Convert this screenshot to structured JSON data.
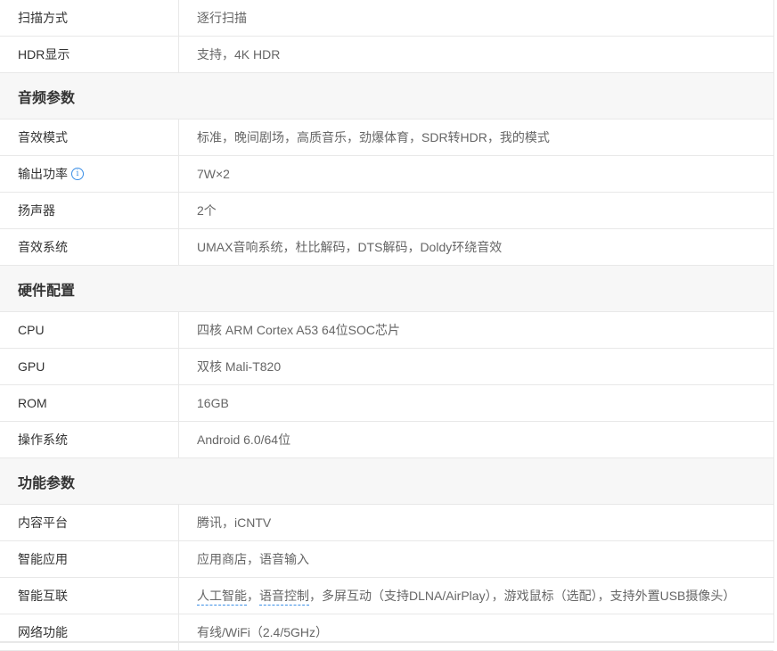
{
  "rows_top": [
    {
      "label": "扫描方式",
      "value": "逐行扫描"
    },
    {
      "label": "HDR显示",
      "value": "支持，4K HDR"
    }
  ],
  "section_audio": "音频参数",
  "rows_audio": [
    {
      "label": "音效模式",
      "value": "标准，晚间剧场，高质音乐，劲爆体育，SDR转HDR，我的模式"
    },
    {
      "label": "输出功率",
      "value": "7W×2",
      "icon": "info-icon"
    },
    {
      "label": "扬声器",
      "value": "2个"
    },
    {
      "label": "音效系统",
      "value": "UMAX音响系统，杜比解码，DTS解码，Doldy环绕音效"
    }
  ],
  "section_hardware": "硬件配置",
  "rows_hardware": [
    {
      "label": "CPU",
      "value": "四核 ARM Cortex A53 64位SOC芯片"
    },
    {
      "label": "GPU",
      "value": "双核 Mali-T820"
    },
    {
      "label": "ROM",
      "value": "16GB"
    },
    {
      "label": "操作系统",
      "value": "Android 6.0/64位"
    }
  ],
  "section_function": "功能参数",
  "rows_function": [
    {
      "label": "内容平台",
      "value": "腾讯，iCNTV"
    },
    {
      "label": "智能应用",
      "value": "应用商店，语音输入"
    },
    {
      "label": "智能互联",
      "link1": "人工智能",
      "sep1": "，",
      "link2": "语音控制",
      "rest": "，多屏互动（支持DLNA/AirPlay），游戏鼠标（选配），支持外置USB摄像头）"
    },
    {
      "label": "网络功能",
      "value": "有线/WiFi（2.4/5GHz）"
    }
  ],
  "colors": {
    "border": "#e8e8e8",
    "section_bg": "#f7f7f7",
    "label_text": "#333333",
    "value_text": "#666666",
    "accent": "#3a8ee6"
  }
}
